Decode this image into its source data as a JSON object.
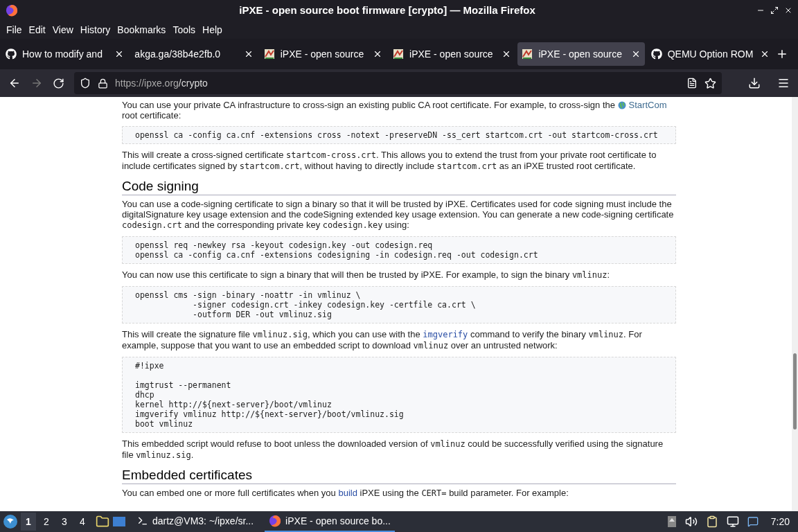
{
  "window": {
    "title": "iPXE - open source boot firmware [crypto] — Mozilla Firefox"
  },
  "menu": [
    "File",
    "Edit",
    "View",
    "History",
    "Bookmarks",
    "Tools",
    "Help"
  ],
  "tabs": [
    {
      "label": "How to modify and",
      "kind": "github",
      "selected": false
    },
    {
      "label": "akga.ga/38b4e2fb.0",
      "kind": "plain",
      "selected": false
    },
    {
      "label": "iPXE - open source",
      "kind": "ipxe",
      "selected": false
    },
    {
      "label": "iPXE - open source",
      "kind": "ipxe",
      "selected": false
    },
    {
      "label": "iPXE - open source",
      "kind": "ipxe",
      "selected": true
    },
    {
      "label": "QEMU Option ROM",
      "kind": "github",
      "selected": false
    }
  ],
  "nav": {
    "back_disabled": false,
    "forward_disabled": true,
    "url_host": "https://ipxe.org",
    "url_path": "/crypto"
  },
  "content": [
    {
      "kind": "para",
      "parts": [
        {
          "kind": "text",
          "text": "You can use your private CA infrastructure to cross-sign an existing public CA root certificate. For example, to cross-sign the "
        },
        {
          "kind": "extlink",
          "text": "StartCom"
        },
        {
          "kind": "text",
          "text": " root certificate:"
        }
      ]
    },
    {
      "kind": "code",
      "lines": [
        "openssl ca -config ca.cnf -extensions cross -notext -preserveDN -ss_cert startcom.crt -out startcom-cross.crt"
      ]
    },
    {
      "kind": "para",
      "parts": [
        {
          "kind": "text",
          "text": "This will create a cross-signed certificate "
        },
        {
          "kind": "code",
          "text": "startcom-cross.crt"
        },
        {
          "kind": "text",
          "text": ". This allows you to extend the trust from your private root certificate to include certificates signed by "
        },
        {
          "kind": "code",
          "text": "startcom.crt"
        },
        {
          "kind": "text",
          "text": ", without having to directly include "
        },
        {
          "kind": "code",
          "text": "startcom.crt"
        },
        {
          "kind": "text",
          "text": " as an iPXE trusted root certificate."
        }
      ]
    },
    {
      "kind": "heading",
      "text": "Code signing"
    },
    {
      "kind": "para",
      "parts": [
        {
          "kind": "text",
          "text": "You can use a code-signing certificate to sign a binary so that it will be trusted by iPXE. Certificates used for code signing must include the digitalSignature key usage extension and the codeSigning extended key usage extension. You can generate a new code-signing certificate "
        },
        {
          "kind": "code",
          "text": "codesign.crt"
        },
        {
          "kind": "text",
          "text": " and the corresponding private key "
        },
        {
          "kind": "code",
          "text": "codesign.key"
        },
        {
          "kind": "text",
          "text": " using:"
        }
      ]
    },
    {
      "kind": "code",
      "lines": [
        "openssl req -newkey rsa -keyout codesign.key -out codesign.req",
        "openssl ca -config ca.cnf -extensions codesigning -in codesign.req -out codesign.crt"
      ]
    },
    {
      "kind": "para",
      "parts": [
        {
          "kind": "text",
          "text": "You can now use this certificate to sign a binary that will then be trusted by iPXE. For example, to sign the binary "
        },
        {
          "kind": "code",
          "text": "vmlinuz"
        },
        {
          "kind": "text",
          "text": ":"
        }
      ]
    },
    {
      "kind": "code",
      "lines": [
        "openssl cms -sign -binary -noattr -in vmlinuz \\",
        "            -signer codesign.crt -inkey codesign.key -certfile ca.crt \\",
        "            -outform DER -out vmlinuz.sig"
      ]
    },
    {
      "kind": "para",
      "parts": [
        {
          "kind": "text",
          "text": "This will create the signature file "
        },
        {
          "kind": "code",
          "text": "vmlinuz.sig"
        },
        {
          "kind": "text",
          "text": ", which you can use with the "
        },
        {
          "kind": "codelink",
          "text": "imgverify"
        },
        {
          "kind": "text",
          "text": " command to verify the binary "
        },
        {
          "kind": "code",
          "text": "vmlinuz"
        },
        {
          "kind": "text",
          "text": ". For example, suppose that you want to use an embedded script to download "
        },
        {
          "kind": "code",
          "text": "vmlinuz"
        },
        {
          "kind": "text",
          "text": " over an untrusted network:"
        }
      ]
    },
    {
      "kind": "code",
      "lines": [
        "#!ipxe\n",
        "imgtrust --permanent",
        "dhcp",
        "kernel http://${next-server}/boot/vmlinuz",
        "imgverify vmlinuz http://${next-server}/boot/vmlinuz.sig",
        "boot vmlinuz"
      ]
    },
    {
      "kind": "para",
      "parts": [
        {
          "kind": "text",
          "text": "This embedded script would refuse to boot unless the downloaded version of "
        },
        {
          "kind": "code",
          "text": "vmlinuz"
        },
        {
          "kind": "text",
          "text": " could be successfully verified using the signature file "
        },
        {
          "kind": "code",
          "text": "vmlinuz.sig"
        },
        {
          "kind": "text",
          "text": "."
        }
      ]
    },
    {
      "kind": "heading",
      "text": "Embedded certificates"
    },
    {
      "kind": "para",
      "parts": [
        {
          "kind": "text",
          "text": "You can embed one or more full certificates when you "
        },
        {
          "kind": "link",
          "text": "build"
        },
        {
          "kind": "text",
          "text": " iPXE using the "
        },
        {
          "kind": "code",
          "text": "CERT="
        },
        {
          "kind": "text",
          "text": " build parameter. For example:"
        }
      ]
    }
  ],
  "taskbar": {
    "workspaces": [
      {
        "label": "1",
        "selected": true
      },
      {
        "label": "2",
        "selected": false
      },
      {
        "label": "3",
        "selected": false
      },
      {
        "label": "4",
        "selected": false
      }
    ],
    "tasks": [
      {
        "label": "dartz@VM3: ~/ipxe/sr...",
        "kind": "terminal",
        "selected": false
      },
      {
        "label": "iPXE - open source bo...",
        "kind": "firefox",
        "selected": true
      }
    ],
    "clock": "7:20"
  }
}
